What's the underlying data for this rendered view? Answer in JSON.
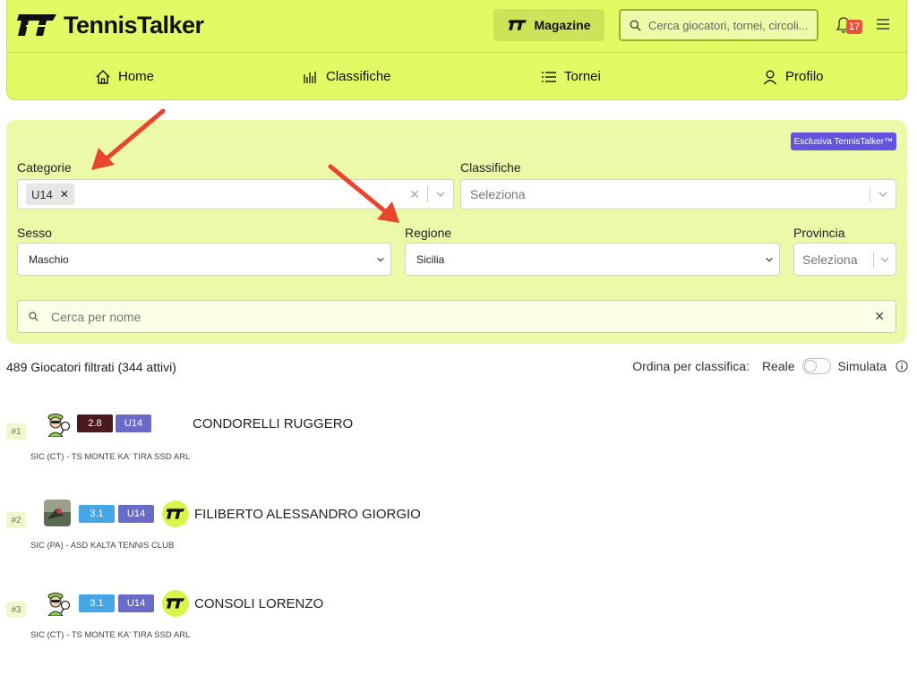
{
  "header": {
    "brand": "TennisTalker",
    "magazine_label": "Magazine",
    "search_placeholder": "Cerca  giocatori, tornei, circoli...",
    "notifications_count": "17",
    "nav": [
      {
        "label": "Home",
        "icon": "home-icon"
      },
      {
        "label": "Classifiche",
        "icon": "bars-icon"
      },
      {
        "label": "Tornei",
        "icon": "list-icon"
      },
      {
        "label": "Profilo",
        "icon": "user-icon"
      }
    ]
  },
  "filters": {
    "exclusive_badge": "Esclusiva TennisTalker™",
    "categorie_label": "Categorie",
    "categorie_chip": "U14",
    "classifiche_label": "Classifiche",
    "classifiche_placeholder": "Seleziona",
    "sesso_label": "Sesso",
    "sesso_value": "Maschio",
    "regione_label": "Regione",
    "regione_value": "Sicilia",
    "provincia_label": "Provincia",
    "provincia_placeholder": "Seleziona",
    "name_search_placeholder": "Cerca per nome"
  },
  "results": {
    "count_text": "489 Giocatori filtrati (344 attivi)",
    "sort_label": "Ordina per classifica:",
    "sort_option_left": "Reale",
    "sort_option_right": "Simulata"
  },
  "players": [
    {
      "rank": "#1",
      "rating": "2.8",
      "rating_color": "#4a1a1f",
      "category": "U14",
      "name": "CONDORELLI RUGGERO",
      "club": "SIC (CT) - TS MONTE KA' TIRA SSD ARL",
      "avatar": "cartoon-player",
      "has_tt_logo": false
    },
    {
      "rank": "#2",
      "rating": "3.1",
      "rating_color": "#45a6e6",
      "category": "U14",
      "name": "FILIBERTO ALESSANDRO GIORGIO",
      "club": "SIC (PA) - ASD KALTA TENNIS CLUB",
      "avatar": "photo",
      "has_tt_logo": true
    },
    {
      "rank": "#3",
      "rating": "3.1",
      "rating_color": "#45a6e6",
      "category": "U14",
      "name": "CONSOLI LORENZO",
      "club": "SIC (CT) - TS MONTE KA' TIRA SSD ARL",
      "avatar": "cartoon-player",
      "has_tt_logo": true
    }
  ],
  "colors": {
    "brand_lime": "#e2fa64",
    "panel_lime": "#ecf9a8",
    "category_badge": "#6a6bc6",
    "exclusive_purple": "#6254e0",
    "annotation_arrow": "#e8452c"
  }
}
